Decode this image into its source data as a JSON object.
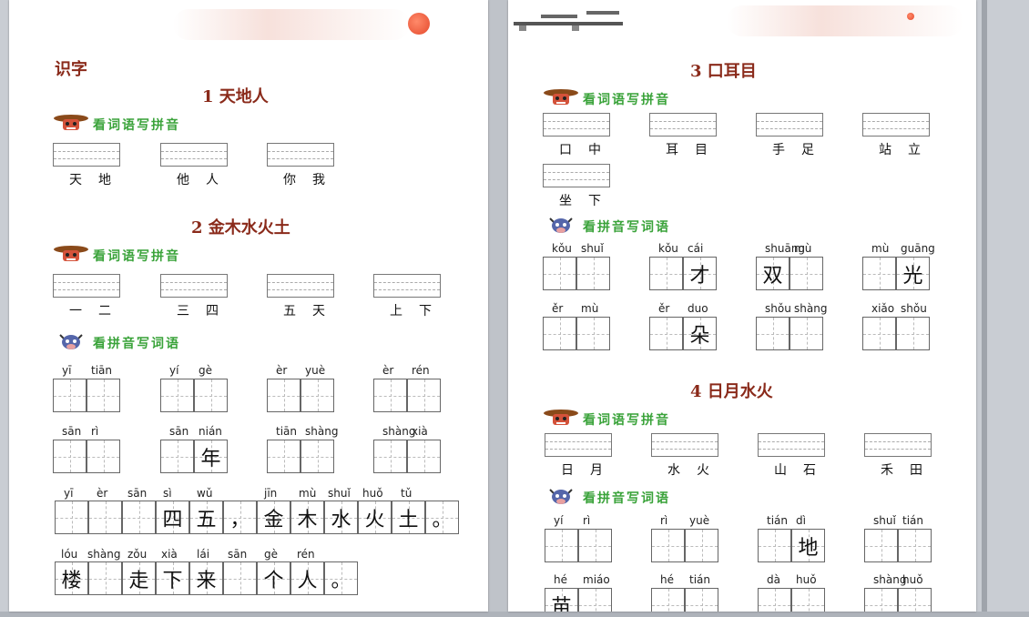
{
  "left_page": {
    "title": "识字",
    "lesson1": {
      "heading": "1  天地人",
      "section": "看词语写拼音",
      "words": [
        "天地",
        "他人",
        "你我"
      ]
    },
    "lesson2": {
      "heading": "2  金木水火土",
      "section1": "看词语写拼音",
      "words": [
        "一二",
        "三四",
        "五天",
        "上下"
      ],
      "section2": "看拼音写词语",
      "row1": [
        {
          "pinyin": [
            "yī",
            "tiān"
          ],
          "chars": [
            "",
            ""
          ]
        },
        {
          "pinyin": [
            "yí",
            "gè"
          ],
          "chars": [
            "",
            ""
          ]
        },
        {
          "pinyin": [
            "èr",
            "yuè"
          ],
          "chars": [
            "",
            ""
          ]
        },
        {
          "pinyin": [
            "èr",
            "rén"
          ],
          "chars": [
            "",
            ""
          ]
        }
      ],
      "row2": [
        {
          "pinyin": [
            "sān",
            "rì"
          ],
          "chars": [
            "",
            ""
          ]
        },
        {
          "pinyin": [
            "sān",
            "nián"
          ],
          "chars": [
            "",
            "年"
          ]
        },
        {
          "pinyin": [
            "tiān",
            "shàng"
          ],
          "chars": [
            "",
            ""
          ]
        },
        {
          "pinyin": [
            "shàng",
            "xià"
          ],
          "chars": [
            "",
            ""
          ]
        }
      ],
      "sentence1": {
        "pinyin": [
          "yī",
          "èr",
          "sān",
          "sì",
          "wǔ",
          "jīn",
          "mù",
          "shuǐ",
          "huǒ",
          "tǔ"
        ],
        "chars": [
          "",
          "",
          "",
          "四",
          "五",
          "，",
          "金",
          "木",
          "水",
          "火",
          "土",
          "。"
        ]
      },
      "sentence2": {
        "pinyin": [
          "lóu",
          "shàng",
          "zǒu",
          "xià",
          "lái",
          "sān",
          "gè",
          "rén"
        ],
        "chars": [
          "楼",
          "",
          "走",
          "下",
          "来",
          "",
          "个",
          "人",
          "。"
        ]
      }
    }
  },
  "right_page": {
    "lesson3": {
      "heading": "3  口耳目",
      "section1": "看词语写拼音",
      "words": [
        "口中",
        "耳目",
        "手足",
        "站立",
        "坐下"
      ],
      "section2": "看拼音写词语",
      "row1": [
        {
          "pinyin": [
            "kǒu",
            "shuǐ"
          ],
          "chars": [
            "",
            ""
          ]
        },
        {
          "pinyin": [
            "kǒu",
            "cái"
          ],
          "chars": [
            "",
            "才"
          ]
        },
        {
          "pinyin": [
            "shuāng",
            "mù"
          ],
          "chars": [
            "双",
            ""
          ]
        },
        {
          "pinyin": [
            "mù",
            "guāng"
          ],
          "chars": [
            "",
            "光"
          ]
        }
      ],
      "row2": [
        {
          "pinyin": [
            "ěr",
            "mù"
          ],
          "chars": [
            "",
            ""
          ]
        },
        {
          "pinyin": [
            "ěr",
            "duo"
          ],
          "chars": [
            "",
            "朵"
          ]
        },
        {
          "pinyin": [
            "shǒu",
            "shàng"
          ],
          "chars": [
            "",
            ""
          ]
        },
        {
          "pinyin": [
            "xiǎo",
            "shǒu"
          ],
          "chars": [
            "",
            ""
          ]
        }
      ]
    },
    "lesson4": {
      "heading": "4  日月水火",
      "section1": "看词语写拼音",
      "words": [
        "日月",
        "水火",
        "山石",
        "禾田"
      ],
      "section2": "看拼音写词语",
      "row1": [
        {
          "pinyin": [
            "yí",
            "rì"
          ],
          "chars": [
            "",
            ""
          ]
        },
        {
          "pinyin": [
            "rì",
            "yuè"
          ],
          "chars": [
            "",
            ""
          ]
        },
        {
          "pinyin": [
            "tián",
            "dì"
          ],
          "chars": [
            "",
            "地"
          ]
        },
        {
          "pinyin": [
            "shuǐ",
            "tián"
          ],
          "chars": [
            "",
            ""
          ]
        }
      ],
      "row2": [
        {
          "pinyin": [
            "hé",
            "miáo"
          ],
          "chars": [
            "苗",
            ""
          ]
        },
        {
          "pinyin": [
            "hé",
            "tián"
          ],
          "chars": [
            "",
            ""
          ]
        },
        {
          "pinyin": [
            "dà",
            "huǒ"
          ],
          "chars": [
            "",
            ""
          ]
        },
        {
          "pinyin": [
            "shàng",
            "huǒ"
          ],
          "chars": [
            "",
            ""
          ]
        }
      ]
    }
  },
  "colors": {
    "heading": "#8a2a1a",
    "section": "#3aa33a",
    "sun": "#e5492c"
  },
  "icons": {
    "mascot_write_pinyin": "hat-mascot-icon",
    "mascot_write_words": "ox-mascot-icon"
  }
}
